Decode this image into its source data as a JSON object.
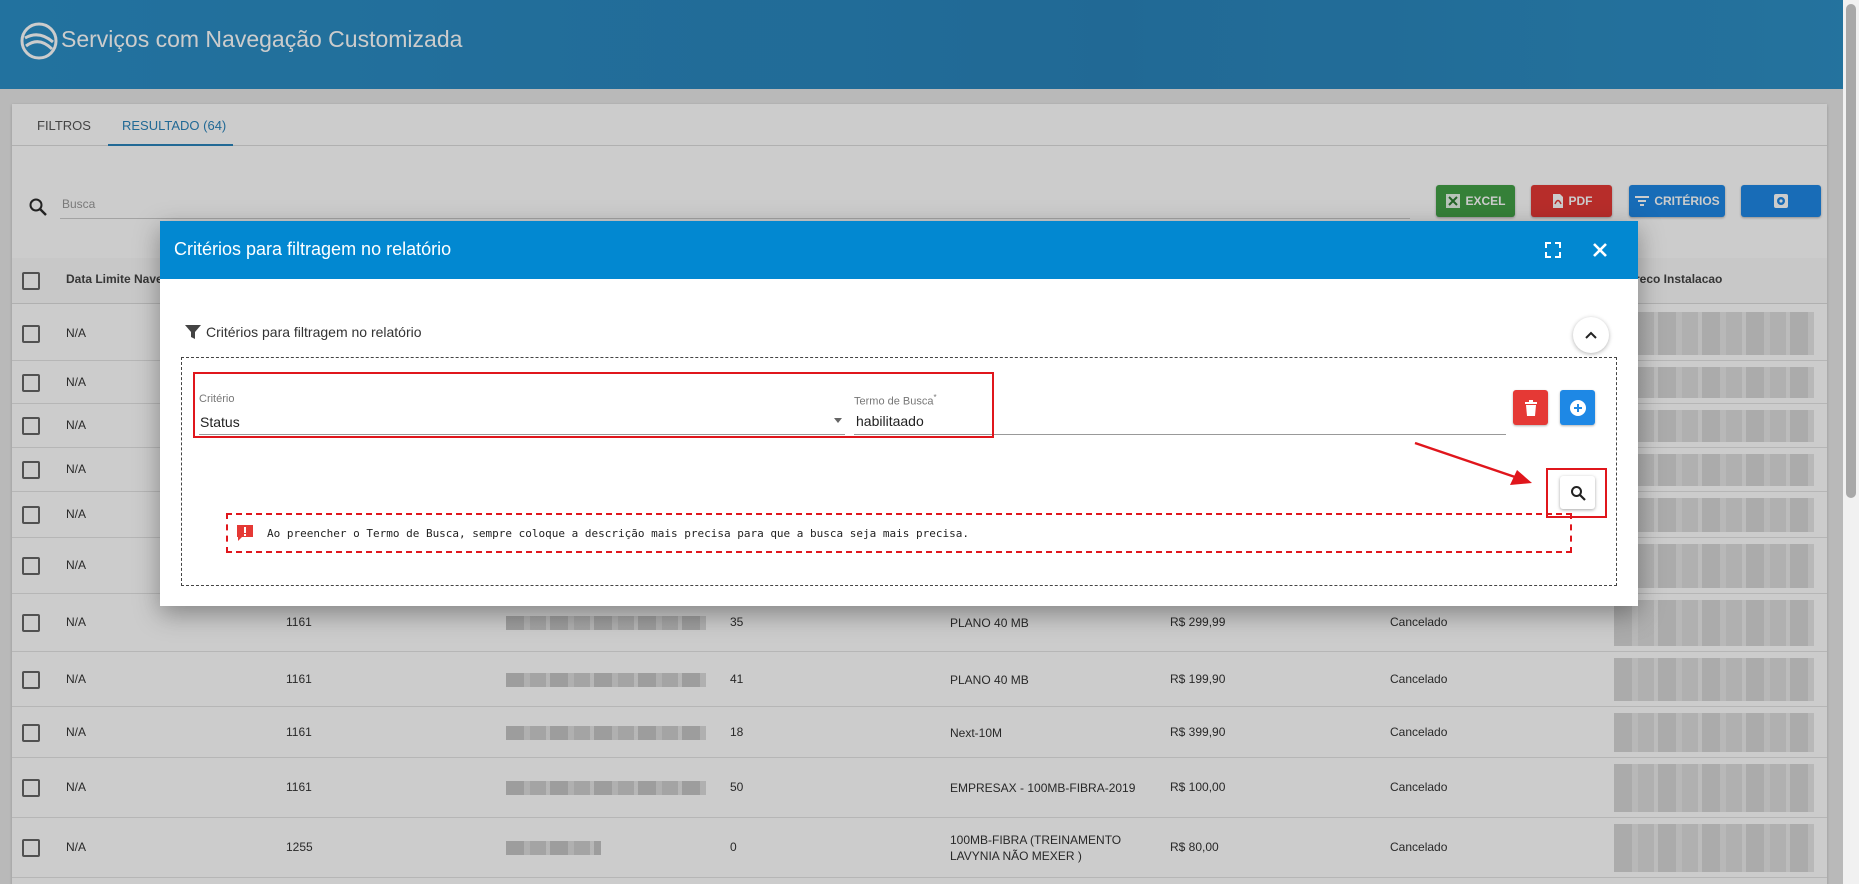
{
  "header": {
    "title": "Serviços com Navegação Customizada"
  },
  "tabs": [
    {
      "label": "FILTROS"
    },
    {
      "label": "RESULTADO (64)"
    }
  ],
  "search": {
    "placeholder": "Busca"
  },
  "toolbar": {
    "excel_label": "EXCEL",
    "pdf_label": "PDF",
    "criterios_label": "CRITÉRIOS"
  },
  "table": {
    "headers": [
      "Data Limite Naveg",
      "reco Instalacao"
    ],
    "rows": [
      {
        "c0": "N/A",
        "c1": "",
        "c2": "",
        "c3": "",
        "c4": "",
        "c5": ""
      },
      {
        "c0": "N/A",
        "c1": "",
        "c2": "",
        "c3": "",
        "c4": "",
        "c5": ""
      },
      {
        "c0": "N/A",
        "c1": "",
        "c2": "",
        "c3": "",
        "c4": "",
        "c5": ""
      },
      {
        "c0": "N/A",
        "c1": "",
        "c2": "",
        "c3": "",
        "c4": "",
        "c5": ""
      },
      {
        "c0": "N/A",
        "c1": "",
        "c2": "",
        "c3": "",
        "c4": "",
        "c5": ""
      },
      {
        "c0": "N/A",
        "c1": "",
        "c2": "",
        "c3": "",
        "c4": "",
        "c5": ""
      },
      {
        "c0": "N/A",
        "c1": "1161",
        "c2": "35",
        "c3": "PLANO 40 MB",
        "c4": "R$ 299,99",
        "c5": "Cancelado"
      },
      {
        "c0": "N/A",
        "c1": "1161",
        "c2": "41",
        "c3": "PLANO 40 MB",
        "c4": "R$ 199,90",
        "c5": "Cancelado"
      },
      {
        "c0": "N/A",
        "c1": "1161",
        "c2": "18",
        "c3": "Next-10M",
        "c4": "R$ 399,90",
        "c5": "Cancelado"
      },
      {
        "c0": "N/A",
        "c1": "1161",
        "c2": "50",
        "c3": "EMPRESAX - 100MB-FIBRA-2019",
        "c4": "R$ 100,00",
        "c5": "Cancelado"
      },
      {
        "c0": "N/A",
        "c1": "1255",
        "c2": "0",
        "c3": "100MB-FIBRA (TREINAMENTO LAVYNIA NÃO MEXER )",
        "c4": "R$ 80,00",
        "c5": "Cancelado"
      }
    ]
  },
  "modal": {
    "title": "Critérios para filtragem no relatório",
    "section_title": "Critérios para filtragem no relatório",
    "criterio_label": "Critério",
    "criterio_value": "Status",
    "termo_label": "Termo de Busca",
    "termo_required": "*",
    "termo_value": "habilitaado",
    "hint": "Ao preencher o Termo de Busca, sempre coloque a descrição mais precisa para que a busca seja mais precisa."
  },
  "colors": {
    "header": "#2a84bb",
    "modal_header": "#0288d1",
    "excel": "#43a047",
    "pdf": "#e53935",
    "primary": "#1e88e5",
    "annotation": "#e0161c"
  },
  "icons": [
    "logo-icon",
    "search-icon",
    "excel-icon",
    "pdf-icon",
    "filter-icon",
    "gear-icon",
    "expand-icon",
    "close-icon",
    "funnel-icon",
    "chevron-up-icon",
    "trash-icon",
    "plus-circle-icon",
    "warning-message-icon"
  ]
}
